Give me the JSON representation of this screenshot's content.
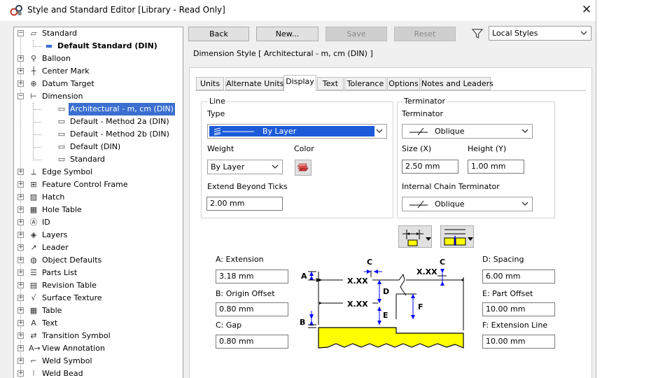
{
  "window": {
    "title": "Style and Standard Editor [Library - Read Only]",
    "close_glyph": "✕"
  },
  "tree": {
    "items": [
      {
        "label": "Standard",
        "icon": "standard-icon",
        "expander": "minus"
      },
      {
        "label": "Default Standard (DIN)",
        "icon": "default-standard-icon",
        "bold": true
      },
      {
        "label": "Balloon",
        "icon": "balloon-icon",
        "expander": "plus"
      },
      {
        "label": "Center Mark",
        "icon": "center-mark-icon",
        "expander": "plus"
      },
      {
        "label": "Datum Target",
        "icon": "datum-target-icon",
        "expander": "plus"
      },
      {
        "label": "Dimension",
        "icon": "dimension-icon",
        "expander": "minus"
      },
      {
        "label": "Architectural - m, cm (DIN)",
        "icon": "dimension-style-icon",
        "selected": true
      },
      {
        "label": "Default - Method 2a (DIN)",
        "icon": "dimension-style-icon"
      },
      {
        "label": "Default - Method 2b (DIN)",
        "icon": "dimension-style-icon"
      },
      {
        "label": "Default (DIN)",
        "icon": "dimension-style-icon"
      },
      {
        "label": "Standard",
        "icon": "dimension-style-icon"
      },
      {
        "label": "Edge Symbol",
        "icon": "edge-symbol-icon",
        "expander": "plus"
      },
      {
        "label": "Feature Control Frame",
        "icon": "feature-control-frame-icon",
        "expander": "plus"
      },
      {
        "label": "Hatch",
        "icon": "hatch-icon",
        "expander": "plus"
      },
      {
        "label": "Hole Table",
        "icon": "hole-table-icon",
        "expander": "plus"
      },
      {
        "label": "ID",
        "icon": "id-icon",
        "expander": "plus"
      },
      {
        "label": "Layers",
        "icon": "layers-icon",
        "expander": "plus"
      },
      {
        "label": "Leader",
        "icon": "leader-icon",
        "expander": "plus"
      },
      {
        "label": "Object Defaults",
        "icon": "object-defaults-icon",
        "expander": "plus"
      },
      {
        "label": "Parts List",
        "icon": "parts-list-icon",
        "expander": "plus"
      },
      {
        "label": "Revision Table",
        "icon": "revision-table-icon",
        "expander": "plus"
      },
      {
        "label": "Surface Texture",
        "icon": "surface-texture-icon",
        "expander": "plus"
      },
      {
        "label": "Table",
        "icon": "table-icon",
        "expander": "plus"
      },
      {
        "label": "Text",
        "icon": "text-icon",
        "expander": "plus"
      },
      {
        "label": "Transition Symbol",
        "icon": "transition-symbol-icon",
        "expander": "plus"
      },
      {
        "label": "View Annotation",
        "icon": "view-annotation-icon",
        "expander": "plus"
      },
      {
        "label": "Weld Symbol",
        "icon": "weld-symbol-icon",
        "expander": "plus"
      },
      {
        "label": "Weld Bead",
        "icon": "weld-bead-icon",
        "expander": "plus"
      }
    ]
  },
  "toolbar": {
    "back_label": "Back",
    "new_label": "New...",
    "save_label": "Save",
    "reset_label": "Reset",
    "filter_icon": "filter-icon",
    "filter_value": "Local Styles"
  },
  "style_header": "Dimension Style [ Architectural - m, cm (DIN) ]",
  "tabs": [
    "Units",
    "Alternate Units",
    "Display",
    "Text",
    "Tolerance",
    "Options",
    "Notes and Leaders"
  ],
  "active_tab": "Display",
  "line_group": {
    "title": "Line",
    "type_label": "Type",
    "type_value": "By Layer",
    "weight_label": "Weight",
    "weight_value": "By Layer",
    "color_label": "Color",
    "extend_label": "Extend Beyond Ticks",
    "extend_value": "2.00 mm"
  },
  "terminator_group": {
    "title": "Terminator",
    "terminator_label": "Terminator",
    "terminator_value": "Oblique",
    "size_label": "Size (X)",
    "size_value": "2.50 mm",
    "height_label": "Height (Y)",
    "height_value": "1.00 mm",
    "chain_label": "Internal Chain Terminator",
    "chain_value": "Oblique"
  },
  "params": {
    "a_label": "A: Extension",
    "a_value": "3.18 mm",
    "b_label": "B: Origin Offset",
    "b_value": "0.80 mm",
    "c_label": "C: Gap",
    "c_value": "0.80 mm",
    "d_label": "D: Spacing",
    "d_value": "6.00 mm",
    "e_label": "E: Part Offset",
    "e_value": "10.00 mm",
    "f_label": "F: Extension Line",
    "f_value": "10.00 mm"
  },
  "diagram": {
    "text_a": "A",
    "text_b": "B",
    "text_c": "C",
    "text_d": "D",
    "text_e": "E",
    "text_f": "F",
    "xx": "X.XX"
  },
  "colors": {
    "selection": "#3a6fd0",
    "part_fill": "#ffff00",
    "arrow_blue": "#0000ff",
    "accent_blue": "#1c5ad8"
  }
}
